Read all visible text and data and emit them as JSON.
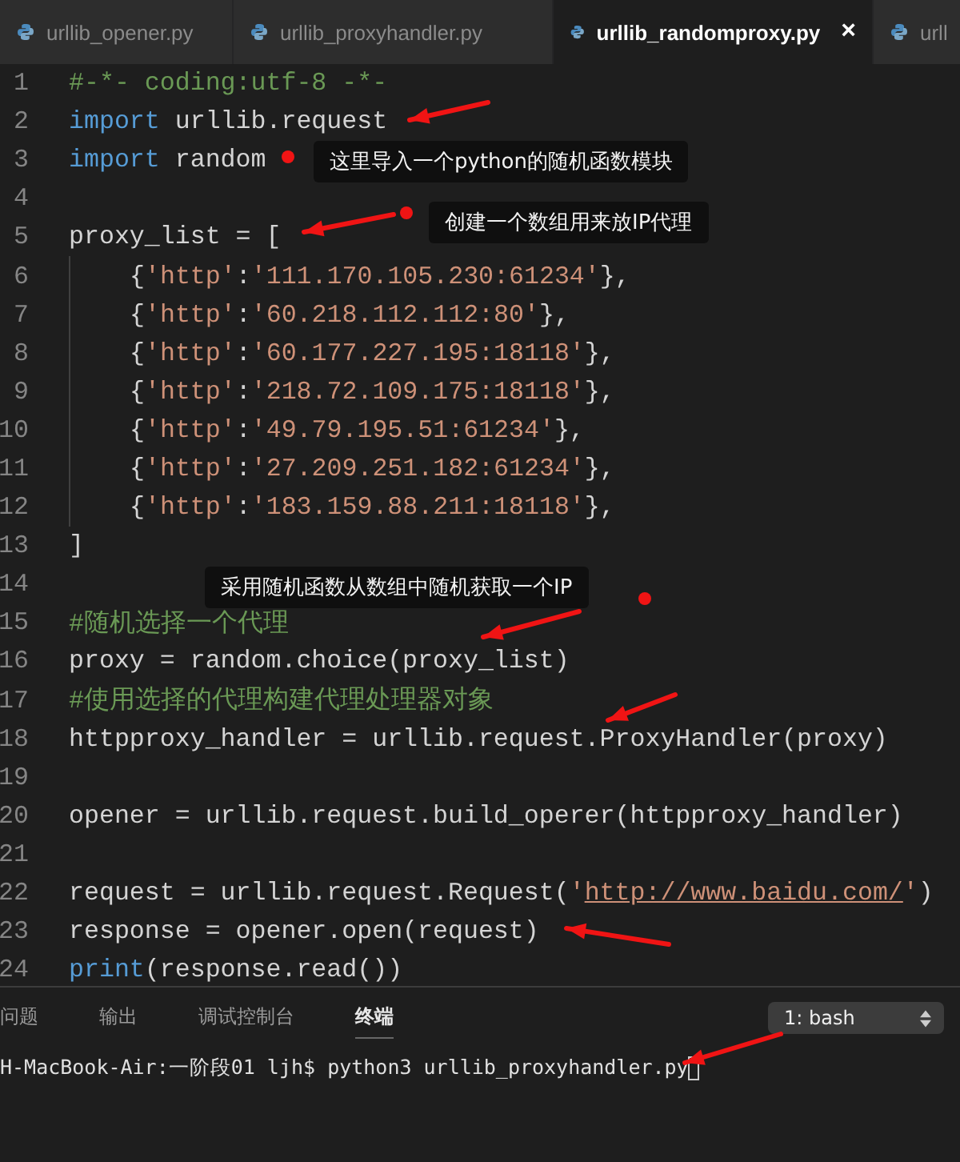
{
  "tabs": [
    {
      "label": "urllib_opener.py",
      "selected": false
    },
    {
      "label": "urllib_proxyhandler.py",
      "selected": false
    },
    {
      "label": "urllib_randomproxy.py",
      "selected": true,
      "close": "×"
    },
    {
      "label": "urll",
      "selected": false
    }
  ],
  "code": [
    {
      "number": "1",
      "indented": false,
      "tokens": [
        {
          "kind": "comment",
          "text": "#-*- coding:utf-8 -*-"
        }
      ]
    },
    {
      "number": "2",
      "indented": false,
      "tokens": [
        {
          "kind": "keyword",
          "text": "import"
        },
        {
          "kind": "plain",
          "text": " urllib.request"
        }
      ]
    },
    {
      "number": "3",
      "indented": false,
      "tokens": [
        {
          "kind": "keyword",
          "text": "import"
        },
        {
          "kind": "plain",
          "text": " random"
        }
      ]
    },
    {
      "number": "4",
      "indented": false
    },
    {
      "number": "5",
      "indented": false,
      "tokens": [
        {
          "kind": "plain",
          "text": "proxy_list = ["
        }
      ]
    },
    {
      "number": "6",
      "indented": true,
      "tokens": [
        {
          "kind": "plain",
          "text": "{"
        },
        {
          "kind": "string",
          "text": "'http'"
        },
        {
          "kind": "plain",
          "text": ":"
        },
        {
          "kind": "string",
          "text": "'111.170.105.230:61234'"
        },
        {
          "kind": "plain",
          "text": "},"
        }
      ]
    },
    {
      "number": "7",
      "indented": true,
      "tokens": [
        {
          "kind": "plain",
          "text": "{"
        },
        {
          "kind": "string",
          "text": "'http'"
        },
        {
          "kind": "plain",
          "text": ":"
        },
        {
          "kind": "string",
          "text": "'60.218.112.112:80'"
        },
        {
          "kind": "plain",
          "text": "},"
        }
      ]
    },
    {
      "number": "8",
      "indented": true,
      "tokens": [
        {
          "kind": "plain",
          "text": "{"
        },
        {
          "kind": "string",
          "text": "'http'"
        },
        {
          "kind": "plain",
          "text": ":"
        },
        {
          "kind": "string",
          "text": "'60.177.227.195:18118'"
        },
        {
          "kind": "plain",
          "text": "},"
        }
      ]
    },
    {
      "number": "9",
      "indented": true,
      "tokens": [
        {
          "kind": "plain",
          "text": "{"
        },
        {
          "kind": "string",
          "text": "'http'"
        },
        {
          "kind": "plain",
          "text": ":"
        },
        {
          "kind": "string",
          "text": "'218.72.109.175:18118'"
        },
        {
          "kind": "plain",
          "text": "},"
        }
      ]
    },
    {
      "number": "10",
      "indented": true,
      "tokens": [
        {
          "kind": "plain",
          "text": "{"
        },
        {
          "kind": "string",
          "text": "'http'"
        },
        {
          "kind": "plain",
          "text": ":"
        },
        {
          "kind": "string",
          "text": "'49.79.195.51:61234'"
        },
        {
          "kind": "plain",
          "text": "},"
        }
      ]
    },
    {
      "number": "11",
      "indented": true,
      "tokens": [
        {
          "kind": "plain",
          "text": "{"
        },
        {
          "kind": "string",
          "text": "'http'"
        },
        {
          "kind": "plain",
          "text": ":"
        },
        {
          "kind": "string",
          "text": "'27.209.251.182:61234'"
        },
        {
          "kind": "plain",
          "text": "},"
        }
      ]
    },
    {
      "number": "12",
      "indented": true,
      "tokens": [
        {
          "kind": "plain",
          "text": "{"
        },
        {
          "kind": "string",
          "text": "'http'"
        },
        {
          "kind": "plain",
          "text": ":"
        },
        {
          "kind": "string",
          "text": "'183.159.88.211:18118'"
        },
        {
          "kind": "plain",
          "text": "},"
        }
      ]
    },
    {
      "number": "13",
      "indented": false,
      "tokens": [
        {
          "kind": "plain",
          "text": "]"
        }
      ]
    },
    {
      "number": "14",
      "indented": false
    },
    {
      "number": "15",
      "indented": false,
      "tokens": [
        {
          "kind": "comment",
          "text": "#随机选择一个代理"
        }
      ]
    },
    {
      "number": "16",
      "indented": false,
      "tokens": [
        {
          "kind": "plain",
          "text": "proxy = random.choice(proxy_list)"
        }
      ]
    },
    {
      "number": "17",
      "indented": false,
      "tokens": [
        {
          "kind": "comment",
          "text": "#使用选择的代理构建代理处理器对象"
        }
      ]
    },
    {
      "number": "18",
      "indented": false,
      "tokens": [
        {
          "kind": "plain",
          "text": "httpproxy_handler = urllib.request.ProxyHandler(proxy)"
        }
      ]
    },
    {
      "number": "19",
      "indented": false
    },
    {
      "number": "20",
      "indented": false,
      "tokens": [
        {
          "kind": "plain",
          "text": "opener = urllib.request.build_operer(httpproxy_handler)"
        }
      ]
    },
    {
      "number": "21",
      "indented": false
    },
    {
      "number": "22",
      "indented": false,
      "tokens": [
        {
          "kind": "plain",
          "text": "request = urllib.request.Request("
        },
        {
          "kind": "string",
          "text": "'"
        },
        {
          "kind": "link",
          "text": "http://www.baidu.com/"
        },
        {
          "kind": "string",
          "text": "'"
        },
        {
          "kind": "plain",
          "text": ")"
        }
      ]
    },
    {
      "number": "23",
      "indented": false,
      "tokens": [
        {
          "kind": "plain",
          "text": "response = opener.open(request)"
        }
      ]
    },
    {
      "number": "24",
      "indented": false,
      "tokens": [
        {
          "kind": "builtin",
          "text": "print"
        },
        {
          "kind": "plain",
          "text": "(response.read())"
        }
      ]
    }
  ],
  "annotations": [
    {
      "text": "这里导入一个python的随机函数模块"
    },
    {
      "text": "创建一个数组用来放IP代理"
    },
    {
      "text": "采用随机函数从数组中随机获取一个IP"
    }
  ],
  "panel_tabs": [
    {
      "label": "问题",
      "selected": false
    },
    {
      "label": "输出",
      "selected": false
    },
    {
      "label": "调试控制台",
      "selected": false
    },
    {
      "label": "终端",
      "selected": true
    }
  ],
  "terminal_select": "1: bash",
  "terminal_line": "H-MacBook-Air:一阶段01 ljh$ python3 urllib_proxyhandler.py"
}
